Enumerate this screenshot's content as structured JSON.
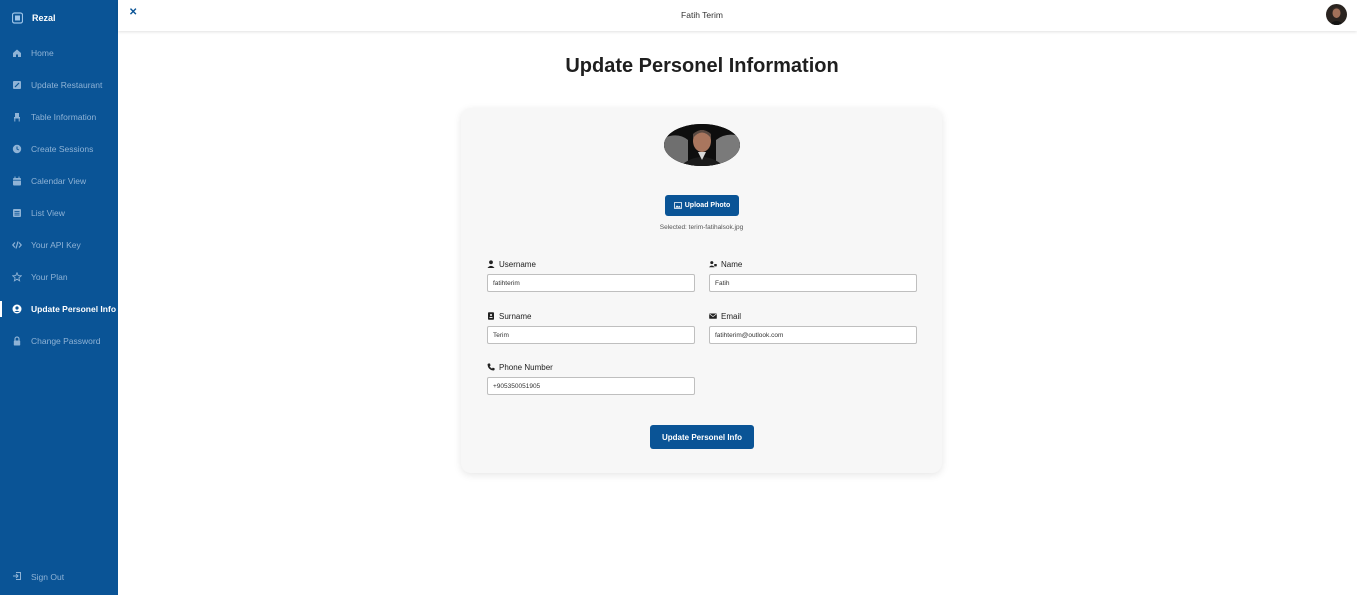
{
  "app": {
    "brand": "Rezal"
  },
  "sidebar": {
    "items": [
      {
        "label": "Home",
        "icon": "home-icon"
      },
      {
        "label": "Update Restaurant",
        "icon": "edit-icon"
      },
      {
        "label": "Table Information",
        "icon": "chair-icon"
      },
      {
        "label": "Create Sessions",
        "icon": "clock-icon"
      },
      {
        "label": "Calendar View",
        "icon": "calendar-icon"
      },
      {
        "label": "List View",
        "icon": "list-icon"
      },
      {
        "label": "Your API Key",
        "icon": "code-icon"
      },
      {
        "label": "Your Plan",
        "icon": "star-icon"
      },
      {
        "label": "Update Personel Info",
        "icon": "user-circle-icon",
        "active": true
      },
      {
        "label": "Change Password",
        "icon": "lock-icon"
      }
    ],
    "signout": "Sign Out"
  },
  "topbar": {
    "close": "✕",
    "user_name": "Fatih Terim"
  },
  "main": {
    "title": "Update Personel Information",
    "upload_label": "Upload Photo",
    "selected_file": "Selected: terim-fatihalsok.jpg",
    "fields": {
      "username": {
        "label": "Username",
        "value": "fatihterim"
      },
      "name": {
        "label": "Name",
        "value": "Fatih"
      },
      "surname": {
        "label": "Surname",
        "value": "Terim"
      },
      "email": {
        "label": "Email",
        "value": "fatihterim@outlook.com"
      },
      "phone": {
        "label": "Phone Number",
        "value": "+905350051905"
      }
    },
    "submit_label": "Update Personel Info"
  },
  "colors": {
    "primary": "#0a5496",
    "inactive_nav": "#8fb3d6",
    "card_bg": "#f7f7f7"
  }
}
